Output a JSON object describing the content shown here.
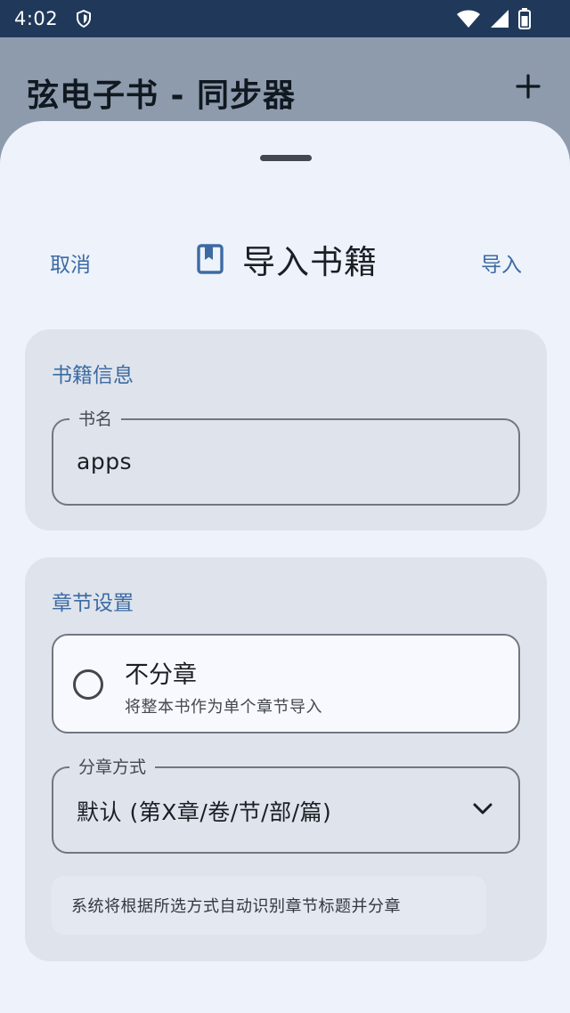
{
  "status_bar": {
    "time": "4:02"
  },
  "app_bar": {
    "title": "弦电子书 - 同步器"
  },
  "sheet": {
    "cancel_label": "取消",
    "title": "导入书籍",
    "import_label": "导入",
    "book_info": {
      "heading": "书籍信息",
      "name_label": "书名",
      "name_value": "apps"
    },
    "chapter_settings": {
      "heading": "章节设置",
      "no_split_title": "不分章",
      "no_split_desc": "将整本书作为单个章节导入",
      "split_method_label": "分章方式",
      "split_method_value": "默认 (第X章/卷/节/部/篇)",
      "hint": "系统将根据所选方式自动识别章节标题并分章"
    }
  },
  "colors": {
    "accent": "#3d6aa3",
    "status_bar": "#20395a",
    "sheet_bg": "#edf2fb",
    "card_bg": "#dfe4ec"
  },
  "icons": {
    "status": [
      "shield-icon",
      "wifi-icon",
      "signal-icon",
      "battery-icon"
    ],
    "app_bar": [
      "add-icon"
    ],
    "sheet": [
      "drag-handle",
      "book-icon",
      "radio-unchecked-icon",
      "chevron-down-icon"
    ]
  }
}
